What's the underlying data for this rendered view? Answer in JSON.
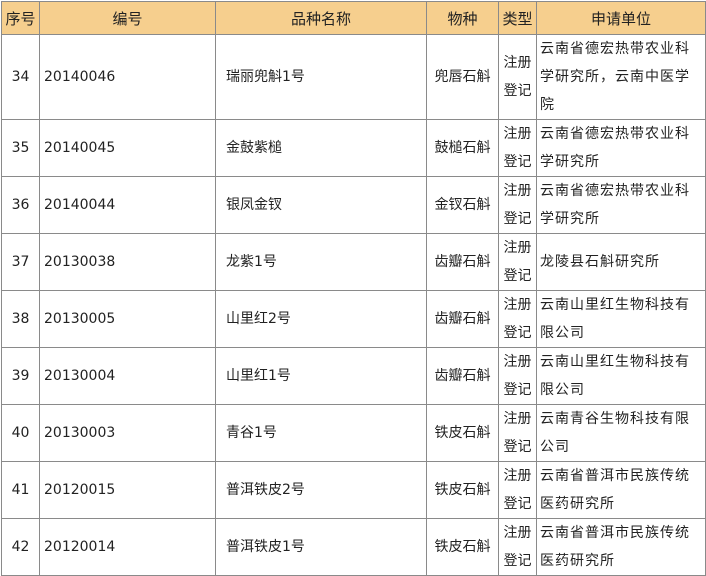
{
  "headers": {
    "index": "序号",
    "code": "编号",
    "name": "品种名称",
    "species": "物种",
    "type": "类型",
    "unit": "申请单位"
  },
  "rows": [
    {
      "index": "34",
      "code": "20140046",
      "name": "瑞丽兜斛1号",
      "species": "兜唇石斛",
      "type": "注册登记",
      "unit": "云南省德宏热带农业科学研究所，云南中医学院"
    },
    {
      "index": "35",
      "code": "20140045",
      "name": "金鼓紫槌",
      "species": "鼓槌石斛",
      "type": "注册登记",
      "unit": "云南省德宏热带农业科学研究所"
    },
    {
      "index": "36",
      "code": "20140044",
      "name": "银凤金钗",
      "species": "金钗石斛",
      "type": "注册登记",
      "unit": "云南省德宏热带农业科学研究所"
    },
    {
      "index": "37",
      "code": "20130038",
      "name": "龙紫1号",
      "species": "齿瓣石斛",
      "type": "注册登记",
      "unit": "龙陵县石斛研究所"
    },
    {
      "index": "38",
      "code": "20130005",
      "name": "山里红2号",
      "species": "齿瓣石斛",
      "type": "注册登记",
      "unit": "云南山里红生物科技有限公司"
    },
    {
      "index": "39",
      "code": "20130004",
      "name": "山里红1号",
      "species": "齿瓣石斛",
      "type": "注册登记",
      "unit": "云南山里红生物科技有限公司"
    },
    {
      "index": "40",
      "code": "20130003",
      "name": "青谷1号",
      "species": "铁皮石斛",
      "type": "注册登记",
      "unit": "云南青谷生物科技有限公司"
    },
    {
      "index": "41",
      "code": "20120015",
      "name": "普洱铁皮2号",
      "species": "铁皮石斛",
      "type": "注册登记",
      "unit": "云南省普洱市民族传统医药研究所"
    },
    {
      "index": "42",
      "code": "20120014",
      "name": "普洱铁皮1号",
      "species": "铁皮石斛",
      "type": "注册登记",
      "unit": "云南省普洱市民族传统医药研究所"
    }
  ]
}
